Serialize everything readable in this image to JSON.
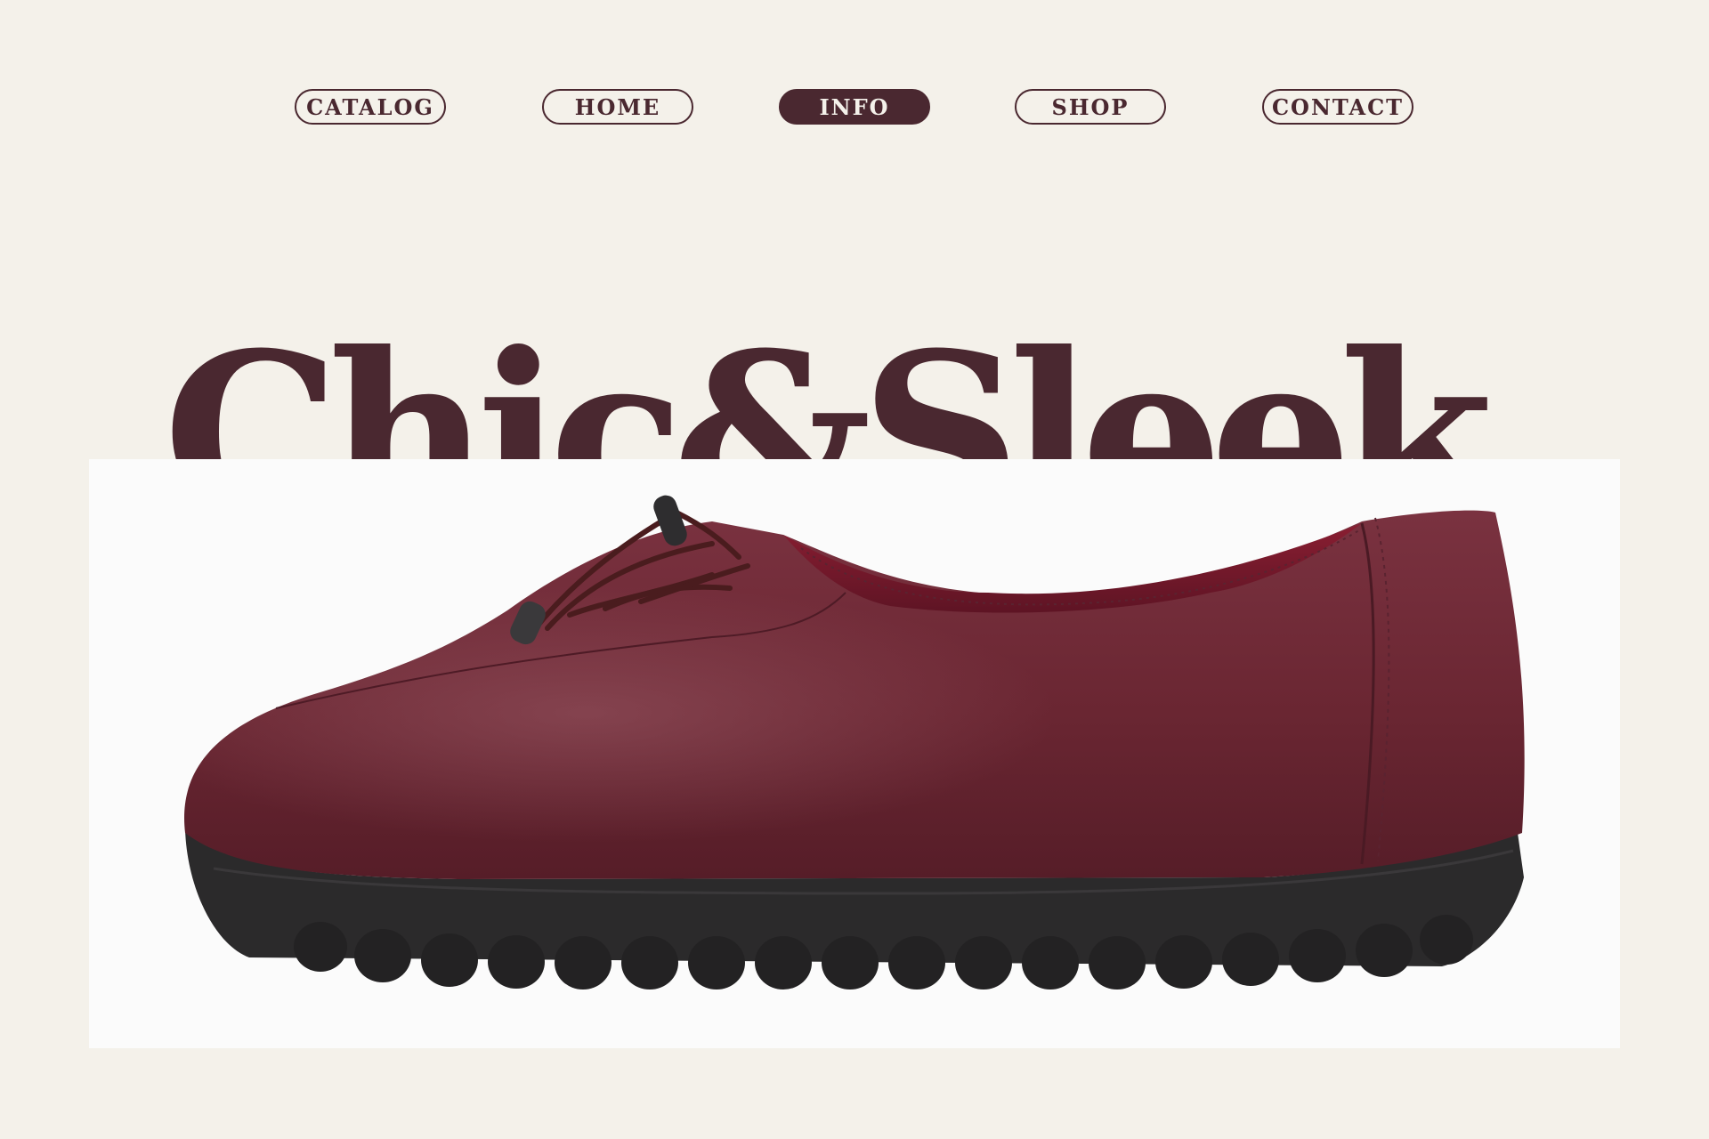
{
  "nav": {
    "items": [
      {
        "label": "CATALOG",
        "active": false
      },
      {
        "label": "HOME",
        "active": false
      },
      {
        "label": "INFO",
        "active": true
      },
      {
        "label": "SHOP",
        "active": false
      },
      {
        "label": "CONTACT",
        "active": false
      }
    ]
  },
  "hero": {
    "headline": "Chic&Sleek."
  },
  "product_image": {
    "subject": "burgundy leather lace-up shoe with black sole"
  },
  "colors": {
    "background": "#f4f1ea",
    "brand": "#4a2830",
    "shoe_leather": "#6e2a35",
    "sole": "#2b2a2b"
  }
}
